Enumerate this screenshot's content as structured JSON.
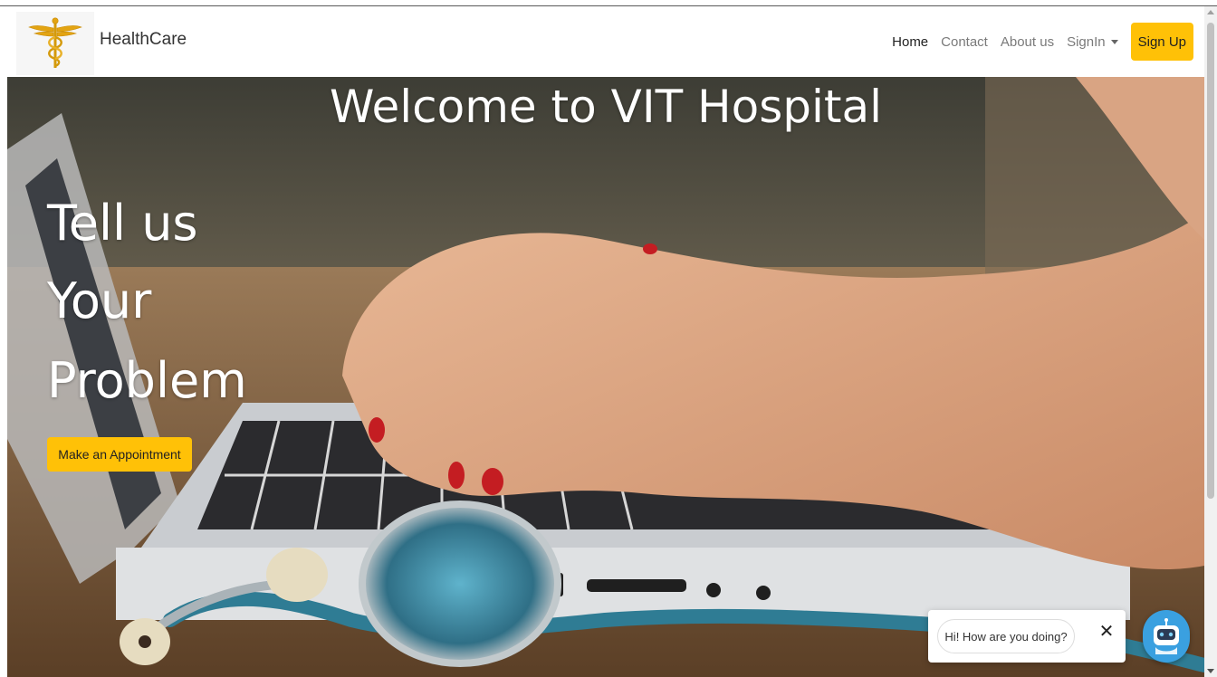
{
  "brand": {
    "name": "HealthCare",
    "icon": "caduceus-icon"
  },
  "nav": {
    "home": "Home",
    "contact": "Contact",
    "about": "About us",
    "signin": "SignIn",
    "signup": "Sign Up"
  },
  "hero": {
    "title": "Welcome to VIT Hospital",
    "lines": [
      "Tell us",
      "Your",
      "Problem"
    ],
    "cta": "Make an Appointment"
  },
  "chat": {
    "greeting": "Hi! How are you doing?",
    "close": "✕",
    "avatar_icon": "chatbot-avatar-icon"
  },
  "colors": {
    "accent": "#ffc107",
    "chat_avatar": "#3aa0e0"
  }
}
